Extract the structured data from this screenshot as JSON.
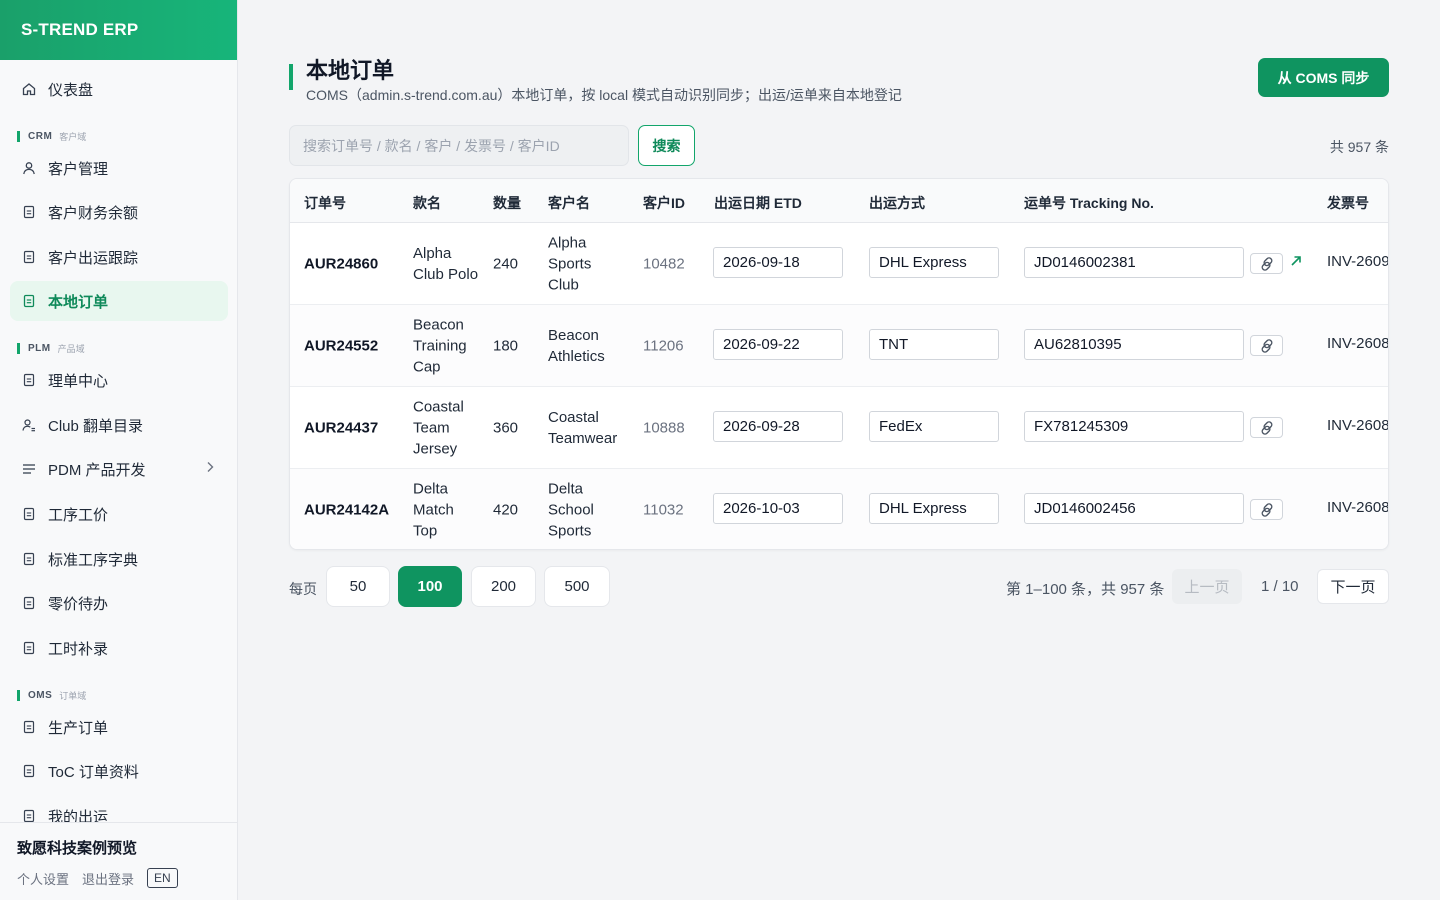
{
  "brand": "S-TREND ERP",
  "nav": {
    "dashboard": "仪表盘",
    "crm_en": "CRM",
    "crm_zh": "客户域",
    "customers": "客户管理",
    "finance": "客户财务余额",
    "shipping": "客户出运跟踪",
    "local_orders": "本地订单",
    "plm_en": "PLM",
    "plm_zh": "产品域",
    "sheet_center": "理单中心",
    "club_catalog": "Club 翻单目录",
    "pdm": "PDM 产品开发",
    "process_cost": "工序工价",
    "process_dict": "标准工序字典",
    "piece_todo": "零价待办",
    "hours_makeup": "工时补录",
    "oms_en": "OMS",
    "oms_zh": "订单域",
    "prod_orders": "生产订单",
    "toc_orders": "ToC 订单资料",
    "my_shipping": "我的出运"
  },
  "footer": {
    "org": "致愿科技案例预览",
    "settings": "个人设置",
    "logout": "退出登录",
    "lang": "EN"
  },
  "header": {
    "title": "本地订单",
    "subtitle": "COMS（admin.s-trend.com.au）本地订单，按 local 模式自动识别同步；出运/运单来自本地登记",
    "sync_label": "从 COMS 同步"
  },
  "search": {
    "placeholder": "搜索订单号 / 款名 / 客户 / 发票号 / 客户ID",
    "button": "搜索",
    "total": "共 957 条"
  },
  "table": {
    "columns": [
      "订单号",
      "款名",
      "数量",
      "客户名",
      "客户ID",
      "出运日期 ETD",
      "出运方式",
      "运单号 Tracking No.",
      "发票号"
    ],
    "rows": [
      {
        "order": "AUR24860",
        "style": "Alpha Club Polo",
        "qty": "240",
        "customer": "Alpha Sports Club",
        "cid": "10482",
        "etd": "2026-09-18",
        "method": "DHL Express",
        "tracking": "JD0146002381",
        "invoice": "INV-2609"
      },
      {
        "order": "AUR24552",
        "style": "Beacon Training Cap",
        "qty": "180",
        "customer": "Beacon Athletics",
        "cid": "11206",
        "etd": "2026-09-22",
        "method": "TNT",
        "tracking": "AU62810395",
        "invoice": "INV-2608"
      },
      {
        "order": "AUR24437",
        "style": "Coastal Team Jersey",
        "qty": "360",
        "customer": "Coastal Teamwear",
        "cid": "10888",
        "etd": "2026-09-28",
        "method": "FedEx",
        "tracking": "FX781245309",
        "invoice": "INV-2608"
      },
      {
        "order": "AUR24142A",
        "style": "Delta Match Top",
        "qty": "420",
        "customer": "Delta School Sports",
        "cid": "11032",
        "etd": "2026-10-03",
        "method": "DHL Express",
        "tracking": "JD0146002456",
        "invoice": "INV-2608"
      }
    ]
  },
  "pagination": {
    "per_page_label": "每页",
    "sizes": [
      "50",
      "100",
      "200",
      "500"
    ],
    "selected_size": "100",
    "range": "第 1–100 条，共 957 条",
    "prev": "上一页",
    "page": "1 / 10",
    "next": "下一页"
  },
  "colors": {
    "accent": "#0f9460",
    "active_bg": "#e8f7ef"
  }
}
